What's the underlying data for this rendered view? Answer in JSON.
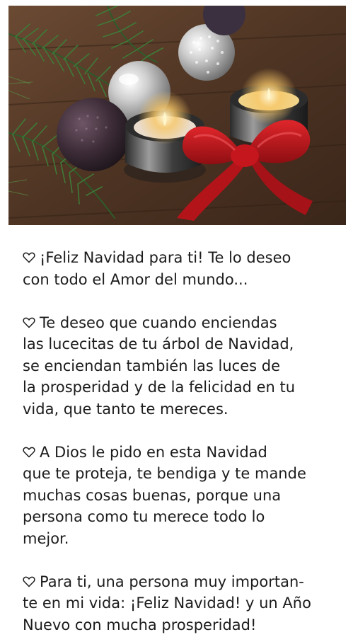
{
  "header_image": {
    "alt_icon": "christmas-candles-bow-image"
  },
  "colors": {
    "text": "#1c1c1c",
    "bow_red": "#c4161c",
    "background": "#ffffff"
  },
  "messages": [
    {
      "icon": "heart-outline-icon",
      "lines": [
        "¡Feliz Navidad para ti! Te lo deseo",
        "con todo el Amor del mundo..."
      ]
    },
    {
      "icon": "heart-outline-icon",
      "lines": [
        "Te deseo que cuando enciendas",
        "las lucecitas de tu árbol de Navidad,",
        "se enciendan también las luces de",
        "la prosperidad y de la felicidad en tu",
        "vida, que tanto te mereces."
      ]
    },
    {
      "icon": "heart-outline-icon",
      "lines": [
        "A Dios le pido en esta Navidad",
        "que te proteja, te bendiga y te mande",
        "muchas cosas buenas, porque una",
        "persona como tu merece todo lo",
        "mejor."
      ]
    },
    {
      "icon": "heart-outline-icon",
      "lines": [
        "Para ti, una persona muy importan-",
        "te en mi vida: ¡Feliz Navidad! y un Año",
        "Nuevo con mucha prosperidad!"
      ]
    }
  ]
}
